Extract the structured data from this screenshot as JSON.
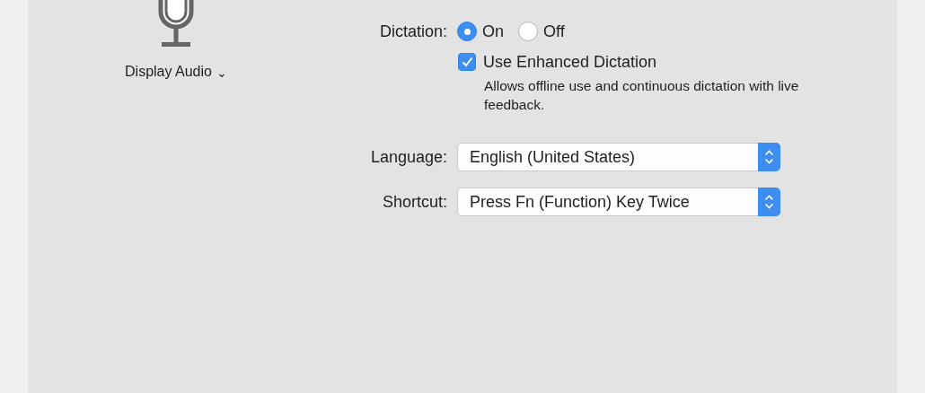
{
  "source": {
    "label": "Display Audio",
    "chevron": "⌄"
  },
  "dictation": {
    "label": "Dictation:",
    "options": [
      {
        "label": "On",
        "selected": true
      },
      {
        "label": "Off",
        "selected": false
      }
    ]
  },
  "enhanced": {
    "label": "Use Enhanced Dictation",
    "checked": true,
    "description": "Allows offline use and continuous dictation with live feedback."
  },
  "popups": [
    {
      "label": "Language:",
      "value": "English (United States)"
    },
    {
      "label": "Shortcut:",
      "value": "Press Fn (Function) Key Twice"
    }
  ]
}
